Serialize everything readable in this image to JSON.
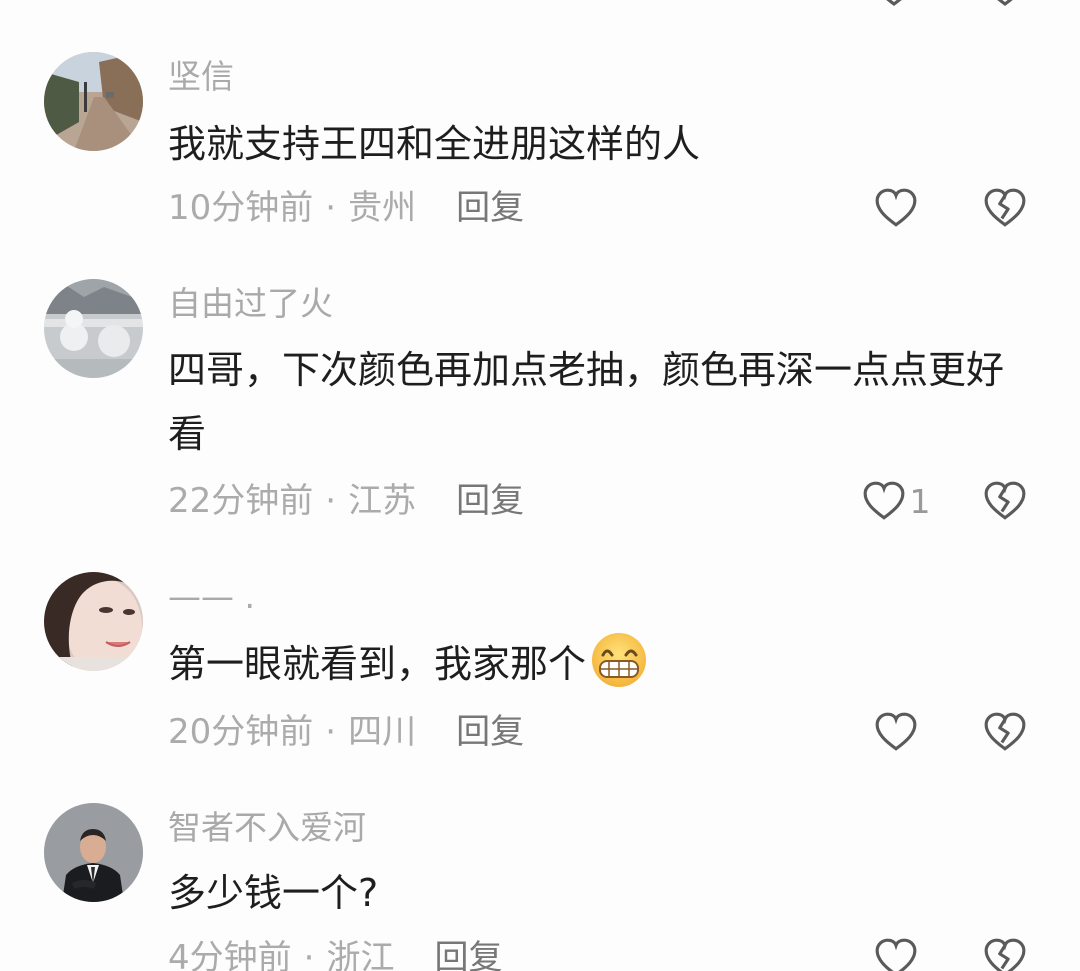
{
  "comments": [
    {
      "username": "坚信",
      "text": "我就支持王四和全进朋这样的人",
      "time": "10分钟前",
      "location": "贵州",
      "reply_label": "回复",
      "like_count": "",
      "avatar": "street-photo-avatar"
    },
    {
      "username": "自由过了火",
      "text": "四哥，下次颜色再加点老抽，颜色再深一点点更好看",
      "time": "22分钟前",
      "location": "江苏",
      "reply_label": "回复",
      "like_count": "1",
      "avatar": "snow-photo-avatar"
    },
    {
      "username": "—— .",
      "text": "第一眼就看到，我家那个",
      "emoji": "grinning-face-emoji",
      "time": "20分钟前",
      "location": "四川",
      "reply_label": "回复",
      "like_count": "",
      "avatar": "woman-photo-avatar"
    },
    {
      "username": "智者不入爱河",
      "text": "多少钱一个?",
      "time": "4分钟前",
      "location": "浙江",
      "reply_label": "回复",
      "like_count": "",
      "avatar": "man-suit-photo-avatar"
    }
  ],
  "meta_separator": "·",
  "icons": {
    "like": "heart-outline-icon",
    "dislike": "broken-heart-icon"
  },
  "colors": {
    "background": "#fdfdfd",
    "username": "#a9a9a9",
    "text": "#1e1e1e",
    "meta": "#ababab",
    "icon_stroke": "#5a5a5a"
  }
}
